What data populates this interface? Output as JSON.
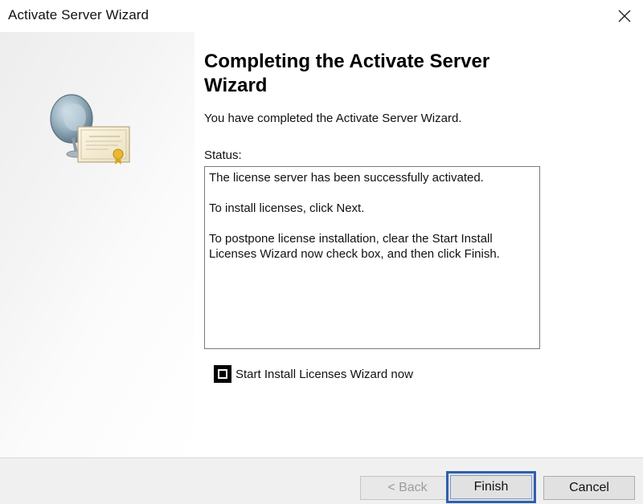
{
  "window": {
    "title": "Activate Server Wizard"
  },
  "icons": {
    "close": "close-icon",
    "banner": "server-certificate-icon",
    "checkbox": "checkbox"
  },
  "content": {
    "heading": "Completing the Activate Server Wizard",
    "intro": "You have completed the Activate Server Wizard.",
    "status_label": "Status:",
    "status_lines": [
      "The license server has been successfully activated.",
      "To install licenses, click Next.",
      "To postpone license installation, clear the Start Install Licenses Wizard now check box, and then click Finish."
    ],
    "checkbox_label": "Start Install Licenses Wizard now",
    "checkbox_checked": true
  },
  "buttons": {
    "back": "< Back",
    "finish": "Finish",
    "cancel": "Cancel"
  },
  "colors": {
    "focus_border": "#2f5fae",
    "footer_bg": "#f0f0f0"
  }
}
